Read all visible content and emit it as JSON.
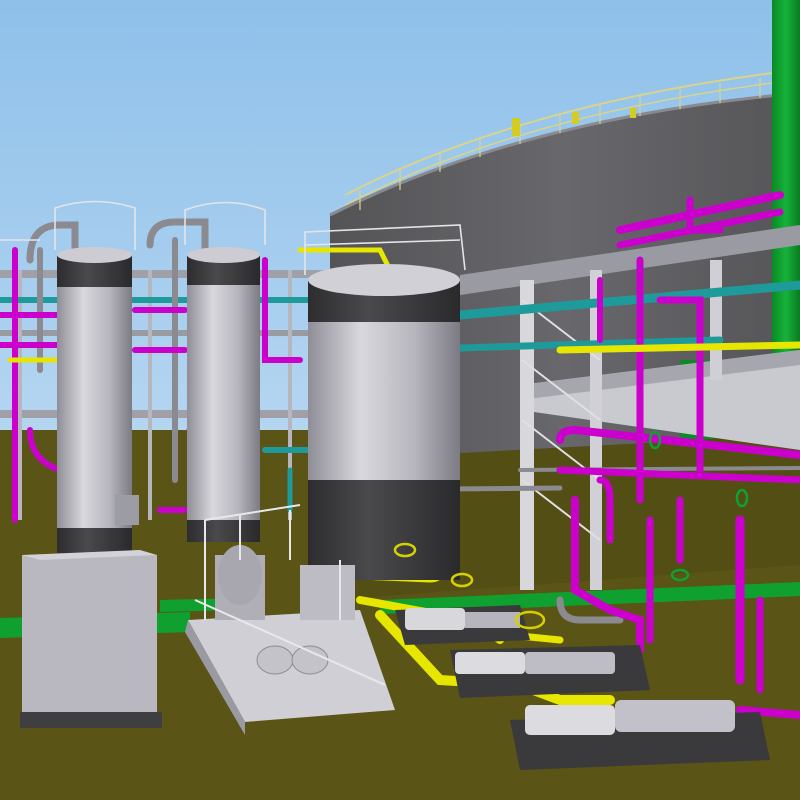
{
  "viewport": {
    "kind": "3d-plant-model-view",
    "background": "sky-gradient"
  },
  "colors": {
    "sky_top": "#8ec0ea",
    "sky_bottom": "#d6e8f6",
    "ground": "#5a5416",
    "tank_wall": "#5f5f62",
    "vessel_body": "#b9b8c0",
    "vessel_band": "#3d3d3f",
    "pipe_magenta": "#cc00cc",
    "pipe_yellow": "#e6e600",
    "pipe_cyan": "#1f9a9a",
    "pipe_grey": "#8a8a90",
    "valve_green": "#10a030",
    "walkway_green": "#0fa030",
    "structure_white": "#d8d8dc"
  },
  "objects": {
    "storage_tank": "storage-tank",
    "stack": "green-stack",
    "vessels": [
      "vertical-vessel-1",
      "vertical-vessel-2",
      "vertical-vessel-3"
    ],
    "skids": [
      "control-cabinet",
      "pump-skid",
      "pump-row"
    ],
    "piping": [
      "magenta-piping",
      "yellow-piping",
      "cyan-piping",
      "grey-piping"
    ],
    "structures": [
      "pipe-rack",
      "handrails"
    ]
  }
}
